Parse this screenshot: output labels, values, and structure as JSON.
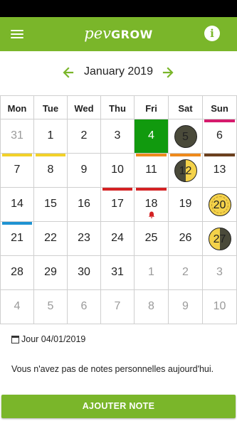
{
  "app": {
    "logo_prefix": "pev",
    "logo_suffix": "GROW"
  },
  "icons": {
    "menu": "menu-icon",
    "info": "info-icon",
    "prev": "arrow-left-icon",
    "next": "arrow-right-icon",
    "calendar": "calendar-icon",
    "bell": "bell-icon"
  },
  "colors": {
    "brand": "#7ab62a",
    "today": "#119a0e",
    "yellow": "#f2d129",
    "orange": "#ee8a1c",
    "brown": "#6b3f1d",
    "magenta": "#d61b6d",
    "red": "#d42224",
    "blue": "#1f93d2"
  },
  "nav": {
    "month_label": "January 2019"
  },
  "calendar": {
    "weekdays": [
      "Mon",
      "Tue",
      "Wed",
      "Thu",
      "Fri",
      "Sat",
      "Sun"
    ],
    "weeks": [
      [
        {
          "label": "31",
          "other": true
        },
        {
          "label": "1"
        },
        {
          "label": "2"
        },
        {
          "label": "3"
        },
        {
          "label": "4",
          "today": true
        },
        {
          "label": "5",
          "moon": "new"
        },
        {
          "label": "6",
          "bar": "#d61b6d"
        }
      ],
      [
        {
          "label": "7",
          "bar": "#f2d129"
        },
        {
          "label": "8",
          "bar": "#f2d129"
        },
        {
          "label": "9"
        },
        {
          "label": "10"
        },
        {
          "label": "11",
          "bar": "#ee8a1c"
        },
        {
          "label": "12",
          "moon": "half",
          "bar": "#ee8a1c"
        },
        {
          "label": "13",
          "bar": "#6b3f1d"
        }
      ],
      [
        {
          "label": "14"
        },
        {
          "label": "15"
        },
        {
          "label": "16"
        },
        {
          "label": "17",
          "bar": "#d42224"
        },
        {
          "label": "18",
          "bar": "#d42224",
          "bell": true
        },
        {
          "label": "19"
        },
        {
          "label": "20",
          "moon": "full"
        }
      ],
      [
        {
          "label": "21",
          "bar": "#1f93d2"
        },
        {
          "label": "22"
        },
        {
          "label": "23"
        },
        {
          "label": "24"
        },
        {
          "label": "25"
        },
        {
          "label": "26"
        },
        {
          "label": "27",
          "moon": "half-rev"
        }
      ],
      [
        {
          "label": "28"
        },
        {
          "label": "29"
        },
        {
          "label": "30"
        },
        {
          "label": "31"
        },
        {
          "label": "1",
          "other": true
        },
        {
          "label": "2",
          "other": true
        },
        {
          "label": "3",
          "other": true
        }
      ],
      [
        {
          "label": "4",
          "other": true
        },
        {
          "label": "5",
          "other": true
        },
        {
          "label": "6",
          "other": true
        },
        {
          "label": "7",
          "other": true
        },
        {
          "label": "8",
          "other": true
        },
        {
          "label": "9",
          "other": true
        },
        {
          "label": "10",
          "other": true
        }
      ]
    ]
  },
  "selected_day": {
    "label": "Jour 04/01/2019"
  },
  "notes": {
    "empty_message": "Vous n'avez pas de notes personnelles aujourd'hui."
  },
  "actions": {
    "add_note": "AJOUTER NOTE"
  }
}
